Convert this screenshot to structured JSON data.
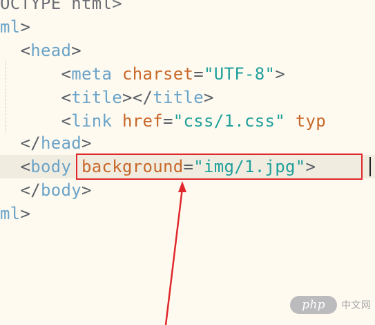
{
  "editor": {
    "lines": [
      {
        "parts": [
          {
            "cls": "t-plain",
            "text": "OCTYPE html>"
          }
        ]
      },
      {
        "parts": [
          {
            "cls": "t-tag",
            "text": "ml"
          },
          {
            "cls": "t-punct",
            "text": ">"
          }
        ]
      },
      {
        "parts": [
          {
            "cls": "t-punct",
            "text": "  <"
          },
          {
            "cls": "t-tag",
            "text": "head"
          },
          {
            "cls": "t-punct",
            "text": ">"
          }
        ]
      },
      {
        "parts": [
          {
            "cls": "t-punct",
            "text": "      <"
          },
          {
            "cls": "t-tag",
            "text": "meta "
          },
          {
            "cls": "t-attr",
            "text": "charset"
          },
          {
            "cls": "t-punct",
            "text": "="
          },
          {
            "cls": "t-str",
            "text": "\"UTF-8\""
          },
          {
            "cls": "t-punct",
            "text": ">"
          }
        ]
      },
      {
        "parts": [
          {
            "cls": "t-punct",
            "text": "      <"
          },
          {
            "cls": "t-tag",
            "text": "title"
          },
          {
            "cls": "t-punct",
            "text": "></"
          },
          {
            "cls": "t-tag",
            "text": "title"
          },
          {
            "cls": "t-punct",
            "text": ">"
          }
        ]
      },
      {
        "parts": [
          {
            "cls": "t-punct",
            "text": "      <"
          },
          {
            "cls": "t-tag",
            "text": "link "
          },
          {
            "cls": "t-attr",
            "text": "href"
          },
          {
            "cls": "t-punct",
            "text": "="
          },
          {
            "cls": "t-str",
            "text": "\"css/1.css\""
          },
          {
            "cls": "t-punct",
            "text": " "
          },
          {
            "cls": "t-attr",
            "text": "typ"
          }
        ]
      },
      {
        "parts": [
          {
            "cls": "t-punct",
            "text": "  </"
          },
          {
            "cls": "t-tag",
            "text": "head"
          },
          {
            "cls": "t-punct",
            "text": ">"
          }
        ]
      },
      {
        "parts": [
          {
            "cls": "t-punct",
            "text": "  <"
          },
          {
            "cls": "t-tag",
            "text": "body "
          },
          {
            "cls": "t-attr",
            "text": "background"
          },
          {
            "cls": "t-punct",
            "text": "="
          },
          {
            "cls": "t-str",
            "text": "\"img/1.jpg\""
          },
          {
            "cls": "t-punct",
            "text": ">"
          }
        ]
      },
      {
        "parts": [
          {
            "cls": "t-punct",
            "text": "  </"
          },
          {
            "cls": "t-tag",
            "text": "body"
          },
          {
            "cls": "t-punct",
            "text": ">"
          }
        ]
      },
      {
        "parts": [
          {
            "cls": "t-tag",
            "text": "ml"
          },
          {
            "cls": "t-punct",
            "text": ">"
          }
        ]
      }
    ]
  },
  "annotation": {
    "box_color": "#e0282c",
    "arrow_color": "#e0282c"
  },
  "watermark": {
    "badge": "php",
    "text": "中文网"
  },
  "colors": {
    "background": "#fefaf0",
    "tag": "#6aa3c8",
    "attribute": "#c8682a",
    "string": "#1f9f9a",
    "punctuation": "#5a5f66"
  }
}
